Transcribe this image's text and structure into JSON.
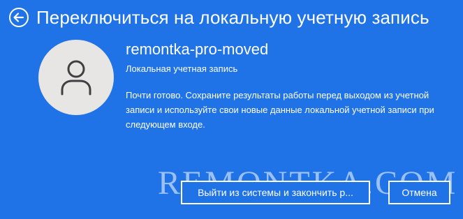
{
  "header": {
    "back_icon": "arrow-left-circle-icon",
    "title": "Переключиться на локальную учетную запись"
  },
  "account": {
    "avatar_icon": "user-icon",
    "username": "remontka-pro-moved",
    "type": "Локальная учетная запись"
  },
  "message": "Почти готово. Сохраните результаты работы перед выходом из учетной записи и используйте свои новые данные локальной учетной записи при следующем входе.",
  "watermark": "REMONTKA.COM",
  "buttons": {
    "signout_label": "Выйти из системы и закончить р...",
    "cancel_label": "Отмена"
  },
  "colors": {
    "background": "#1f73e6",
    "text": "#ffffff",
    "avatar_bg": "#e8e6e4",
    "avatar_icon": "#404040"
  }
}
